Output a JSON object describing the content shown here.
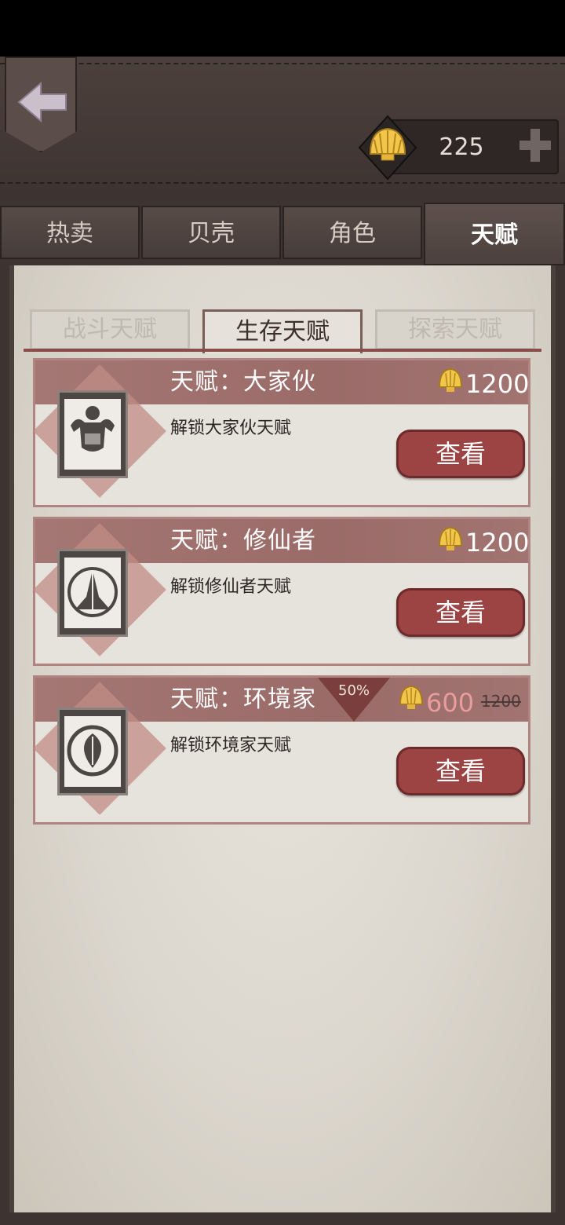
{
  "header": {
    "currency_value": "225",
    "icons": [
      "back-arrow-icon",
      "shell-icon",
      "plus-icon"
    ]
  },
  "tabs": [
    {
      "label": "热卖",
      "active": false
    },
    {
      "label": "贝壳",
      "active": false
    },
    {
      "label": "角色",
      "active": false
    },
    {
      "label": "天赋",
      "active": true
    }
  ],
  "subtabs": [
    {
      "label": "战斗天赋",
      "active": false
    },
    {
      "label": "生存天赋",
      "active": true
    },
    {
      "label": "探索天赋",
      "active": false
    }
  ],
  "cards": [
    {
      "title": "天赋：大家伙",
      "description": "解锁大家伙天赋",
      "price": "1200",
      "button": "查看",
      "icon": "muscle-man-icon"
    },
    {
      "title": "天赋：修仙者",
      "description": "解锁修仙者天赋",
      "price": "1200",
      "button": "查看",
      "icon": "praying-hands-icon"
    },
    {
      "title": "天赋：环境家",
      "description": "解锁环境家天赋",
      "price": "600",
      "original_price": "1200",
      "discount": "50%",
      "button": "查看",
      "icon": "leaf-recycle-icon"
    }
  ],
  "colors": {
    "accent": "#9b4443",
    "card_header": "#a57774",
    "sale_price": "#e99c9c"
  }
}
